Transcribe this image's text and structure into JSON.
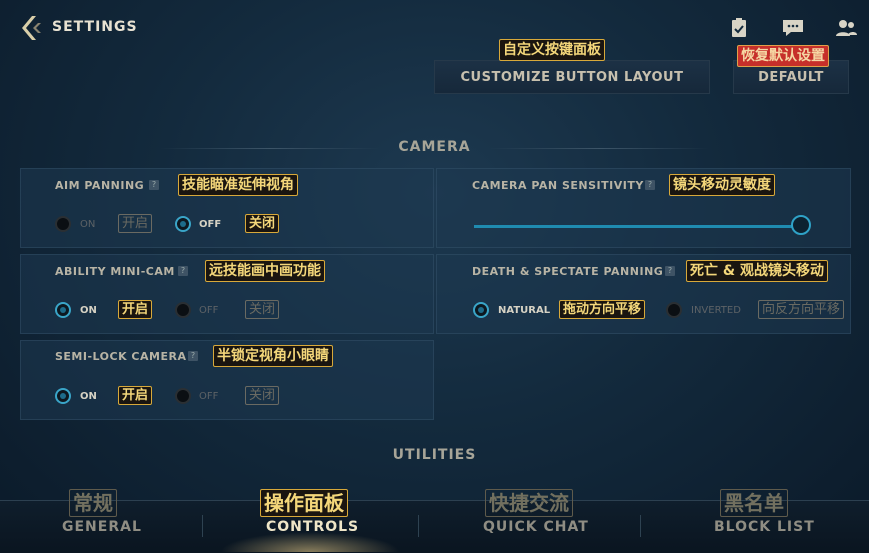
{
  "header": {
    "title": "SETTINGS"
  },
  "top_buttons": {
    "customize": {
      "label": "CUSTOMIZE BUTTON LAYOUT",
      "tag": "自定义按键面板"
    },
    "default": {
      "label": "DEFAULT",
      "tag": "恢复默认设置"
    }
  },
  "camera": {
    "section_title": "CAMERA",
    "aim_panning": {
      "label": "AIM PANNING",
      "tag": "技能瞄准延伸视角",
      "on": "ON",
      "off": "OFF",
      "on_tag": "开启",
      "off_tag": "关闭",
      "selected": "OFF"
    },
    "ability_mini_cam": {
      "label": "ABILITY MINI-CAM",
      "tag": "远技能画中画功能",
      "on": "ON",
      "off": "OFF",
      "on_tag": "开启",
      "off_tag": "关闭",
      "selected": "ON"
    },
    "semi_lock_camera": {
      "label": "SEMI-LOCK CAMERA",
      "tag": "半锁定视角小眼睛",
      "on": "ON",
      "off": "OFF",
      "on_tag": "开启",
      "off_tag": "关闭",
      "selected": "ON"
    },
    "pan_sensitivity": {
      "label": "CAMERA PAN SENSITIVITY",
      "tag": "镜头移动灵敏度",
      "value": 1.0
    },
    "death_spectate": {
      "label": "DEATH & SPECTATE PANNING",
      "tag": "死亡 & 观战镜头移动",
      "natural": "NATURAL",
      "inverted": "INVERTED",
      "natural_tag": "拖动方向平移",
      "inverted_tag": "向反方向平移",
      "selected": "NATURAL"
    }
  },
  "utilities": {
    "section_title": "UTILITIES"
  },
  "bottom_nav": {
    "items": [
      {
        "label": "GENERAL",
        "tag": "常规"
      },
      {
        "label": "CONTROLS",
        "tag": "操作面板"
      },
      {
        "label": "QUICK CHAT",
        "tag": "快捷交流"
      },
      {
        "label": "BLOCK LIST",
        "tag": "黑名单"
      }
    ],
    "active": "CONTROLS"
  },
  "colors": {
    "accent": "#3aa5c8",
    "tag_border": "#d8a93a",
    "tag_text": "#f4d77a",
    "default_tag_bg": "#c62f2a"
  }
}
